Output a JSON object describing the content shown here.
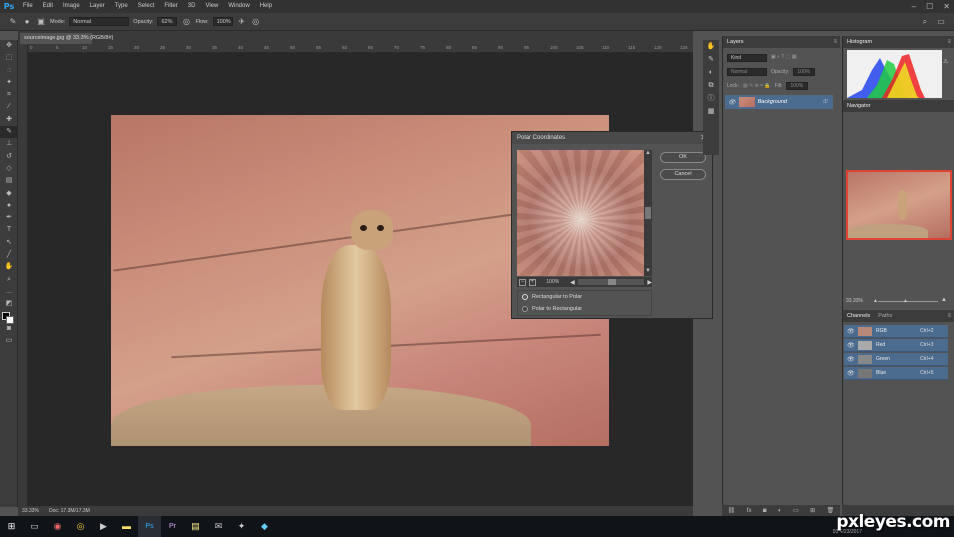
{
  "app": {
    "logo": "Ps"
  },
  "menubar": {
    "items": [
      "File",
      "Edit",
      "Image",
      "Layer",
      "Type",
      "Select",
      "Filter",
      "3D",
      "View",
      "Window",
      "Help"
    ],
    "min": "–",
    "max": "☐",
    "close": "✕"
  },
  "options": {
    "mode_label": "Mode:",
    "mode_value": "Normal",
    "opacity_label": "Opacity:",
    "opacity_value": "62%",
    "flow_label": "Flow:",
    "flow_value": "100%"
  },
  "document": {
    "tab_title": "sourceimage.jpg @ 33.3% (RGB/8#)",
    "ruler_ticks": [
      "0",
      "5",
      "10",
      "15",
      "20",
      "25",
      "30",
      "35",
      "40",
      "45",
      "50",
      "55",
      "60",
      "65",
      "70",
      "75",
      "80",
      "85",
      "90",
      "95",
      "100",
      "105",
      "110",
      "115",
      "120",
      "125"
    ]
  },
  "status": {
    "zoom": "33.33%",
    "doc": "Doc: 17.3M/17.3M"
  },
  "dialog": {
    "title": "Polar Coordinates",
    "ok_label": "OK",
    "cancel_label": "Cancel",
    "zoom": "100%",
    "options": [
      {
        "label": "Rectangular to Polar",
        "selected": true
      },
      {
        "label": "Polar to Rectangular",
        "selected": false
      }
    ]
  },
  "layers": {
    "title": "Layers",
    "search_placeholder": "Kind",
    "blend": "Normal",
    "opacity_label": "Opacity:",
    "opacity_value": "100%",
    "lock_label": "Lock:",
    "fill_label": "Fill:",
    "fill_value": "100%",
    "items": [
      {
        "name": "Background",
        "lock_icon": "lock-icon"
      }
    ]
  },
  "histogram": {
    "title": "Histogram"
  },
  "navigator": {
    "title": "Navigator",
    "zoom": "33.33%"
  },
  "channels": {
    "tabs": [
      "Channels",
      "Paths"
    ],
    "items": [
      {
        "name": "RGB",
        "shortcut": "Ctrl+2"
      },
      {
        "name": "Red",
        "shortcut": "Ctrl+3"
      },
      {
        "name": "Green",
        "shortcut": "Ctrl+4"
      },
      {
        "name": "Blue",
        "shortcut": "Ctrl+5"
      }
    ]
  },
  "taskbar": {
    "date": "4/23/2017",
    "time": "03"
  },
  "watermark": "pxleyes.com",
  "colors": {
    "accent": "#31a8ff",
    "selection": "#4b6b8f",
    "nav_frame": "#dd4433"
  }
}
